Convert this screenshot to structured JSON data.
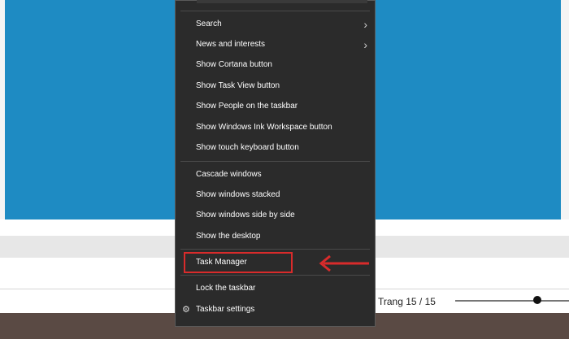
{
  "context_menu": {
    "items": [
      {
        "label": "Search",
        "has_submenu": true
      },
      {
        "label": "News and interests",
        "has_submenu": true
      },
      {
        "label": "Show Cortana button"
      },
      {
        "label": "Show Task View button"
      },
      {
        "label": "Show People on the taskbar"
      },
      {
        "label": "Show Windows Ink Workspace button"
      },
      {
        "label": "Show touch keyboard button"
      },
      {
        "label": "Cascade windows"
      },
      {
        "label": "Show windows stacked"
      },
      {
        "label": "Show windows side by side"
      },
      {
        "label": "Show the desktop"
      },
      {
        "label": "Task Manager",
        "highlighted": true
      },
      {
        "label": "Lock the taskbar"
      },
      {
        "label": "Taskbar settings",
        "icon": "gear-icon"
      }
    ]
  },
  "status_bar": {
    "page_indicator": "Trang 15 / 15",
    "zoom_level_fraction": 0.69
  },
  "annotation": {
    "highlight_color": "#d92b2b",
    "arrow_icon": "left-arrow-icon"
  },
  "colors": {
    "menu_background": "#2b2b2b",
    "desktop_blue": "#1e8bc3",
    "bottom_strip": "#5a4a44"
  }
}
